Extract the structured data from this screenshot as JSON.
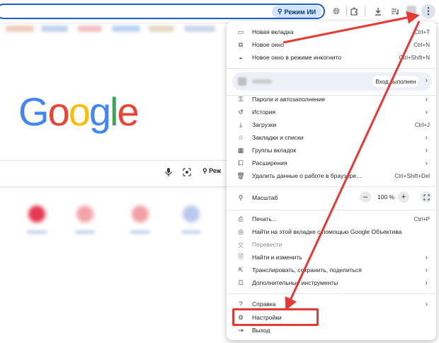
{
  "toolbar": {
    "ai_mode_label": "Режим ИИ",
    "ai_icon": "sparkle-search-icon",
    "icons": [
      "globe-icon",
      "extensions-icon",
      "download-icon",
      "media-queue-icon",
      "more-vert-icon"
    ]
  },
  "page": {
    "logo_letters": [
      {
        "ch": "G",
        "color": "#4285f4"
      },
      {
        "ch": "o",
        "color": "#ea4335"
      },
      {
        "ch": "o",
        "color": "#fbbc05"
      },
      {
        "ch": "g",
        "color": "#4285f4"
      },
      {
        "ch": "l",
        "color": "#34a853"
      },
      {
        "ch": "e",
        "color": "#ea4335"
      }
    ],
    "search_ai_label": "Реж",
    "tile_colors": [
      "#e53950",
      "#f5a3a8",
      "#f2a0a5",
      "#b9c8ef",
      "#c7d3f2"
    ]
  },
  "menu": {
    "new_tab": {
      "label": "Новая вкладка",
      "shortcut": "Ctrl+T"
    },
    "new_window": {
      "label": "Новое окно",
      "shortcut": "Ctrl+N"
    },
    "incognito": {
      "label": "Новое окно в режиме инкогнито",
      "shortcut": "Ctrl+Shift+N"
    },
    "profile": {
      "status": "Вход выполнен"
    },
    "passwords": {
      "label": "Пароли и автозаполнение"
    },
    "history": {
      "label": "История"
    },
    "downloads": {
      "label": "Загрузки",
      "shortcut": "Ctrl+J"
    },
    "bookmarks": {
      "label": "Закладки и списки"
    },
    "tab_groups": {
      "label": "Группы вкладок"
    },
    "extensions": {
      "label": "Расширения"
    },
    "clear_data": {
      "label": "Удалить данные о работе в браузере...",
      "shortcut": "Ctrl+Shift+Del"
    },
    "zoom": {
      "label": "Масштаб",
      "value": "100 %",
      "minus": "–",
      "plus": "+"
    },
    "print": {
      "label": "Печать...",
      "shortcut": "Ctrl+P"
    },
    "lens": {
      "label": "Найти на этой вкладке с помощью Google Объектива"
    },
    "translate": {
      "label": "Перевести"
    },
    "find": {
      "label": "Найти и изменить"
    },
    "cast": {
      "label": "Транслировать, сохранить, поделиться"
    },
    "more_tools": {
      "label": "Дополнительные инструменты"
    },
    "help": {
      "label": "Справка"
    },
    "settings": {
      "label": "Настройки"
    },
    "exit": {
      "label": "Выход"
    }
  },
  "annotation": {
    "arrow_color": "#e53935"
  }
}
